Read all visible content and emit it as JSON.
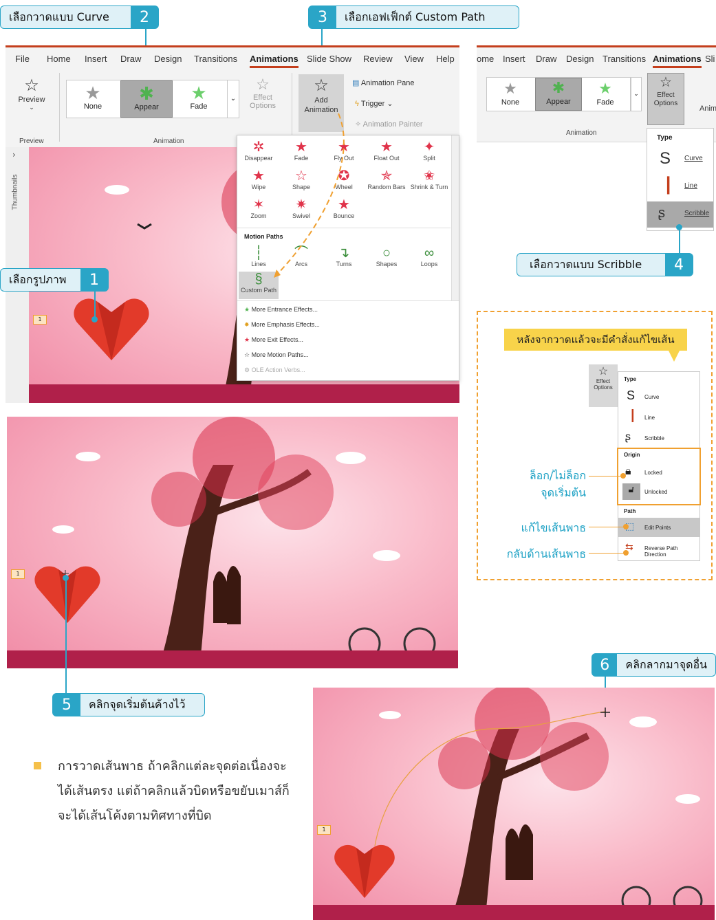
{
  "callouts": {
    "c1": {
      "label": "เลือกรูปภาพ",
      "num": "1"
    },
    "c2": {
      "label": "เลือกวาดแบบ Curve",
      "num": "2"
    },
    "c3": {
      "label": "เลือกเอฟเฟ็กต์ Custom Path",
      "num": "3"
    },
    "c4": {
      "label": "เลือกวาดแบบ Scribble",
      "num": "4"
    },
    "c5": {
      "label": "คลิกจุดเริ่มต้นค้างไว้",
      "num": "5"
    },
    "c6": {
      "label": "คลิกลากมาจุดอื่น",
      "num": "6"
    }
  },
  "ribbon1": {
    "tabs": [
      "File",
      "Home",
      "Insert",
      "Draw",
      "Design",
      "Transitions",
      "Animations",
      "Slide Show",
      "Review",
      "View",
      "Help"
    ],
    "preview": "Preview",
    "preview_group": "Preview",
    "animation_group": "Animation",
    "gallery": [
      "None",
      "Appear",
      "Fade"
    ],
    "effect_options": "Effect Options",
    "add_animation": "Add Animation",
    "animation_pane": "Animation Pane",
    "trigger": "Trigger",
    "animation_painter": "Animation Painter",
    "thumbnails": "Thumbnails"
  },
  "dropdown": {
    "exit": [
      "Disappear",
      "Fade",
      "Fly Out",
      "Float Out",
      "Split",
      "Wipe",
      "Shape",
      "Wheel",
      "Random Bars",
      "Shrink & Turn",
      "Zoom",
      "Swivel",
      "Bounce"
    ],
    "motion_header": "Motion Paths",
    "motion": [
      "Lines",
      "Arcs",
      "Turns",
      "Shapes",
      "Loops"
    ],
    "custom_path": "Custom Path",
    "more": [
      "More Entrance Effects...",
      "More Emphasis Effects...",
      "More Exit Effects...",
      "More Motion Paths...",
      "OLE Action Verbs..."
    ]
  },
  "ribbon2": {
    "tabs": [
      "ome",
      "Insert",
      "Draw",
      "Design",
      "Transitions",
      "Animations",
      "Sli"
    ],
    "gallery": [
      "None",
      "Appear",
      "Fade"
    ],
    "effect_options": "Effect Options",
    "anim": "Anim",
    "group": "Animation",
    "menu_type": "Type",
    "menu_items": [
      "Curve",
      "Line",
      "Scribble"
    ]
  },
  "panel": {
    "banner": "หลังจากวาดแล้วจะมีคำสั่งแก้ไขเส้น",
    "effect_options": "Effect Options",
    "type_head": "Type",
    "types": [
      "Curve",
      "Line",
      "Scribble"
    ],
    "origin_head": "Origin",
    "origins": [
      "Locked",
      "Unlocked"
    ],
    "path_head": "Path",
    "paths": [
      "Edit Points",
      "Reverse Path Direction"
    ],
    "anno_lock_1": "ล็อก/ไม่ล็อก",
    "anno_lock_2": "จุดเริ่มต้น",
    "anno_edit": "แก้ไขเส้นพาธ",
    "anno_reverse": "กลับด้านเส้นพาธ"
  },
  "slide_tag": "1",
  "body_text": "การวาดเส้นพาธ ถ้าคลิกแต่ละจุดต่อเนื่องจะได้เส้นตรง แต่ถ้าคลิกแล้วบิดหรือขยับเมาส์ก็จะได้เส้นโค้งตามทิศทางที่บิด",
  "colors": {
    "accent": "#2aa5c7",
    "orange": "#f0a030",
    "banner": "#f8d34a",
    "bullet": "#f5c04a"
  }
}
